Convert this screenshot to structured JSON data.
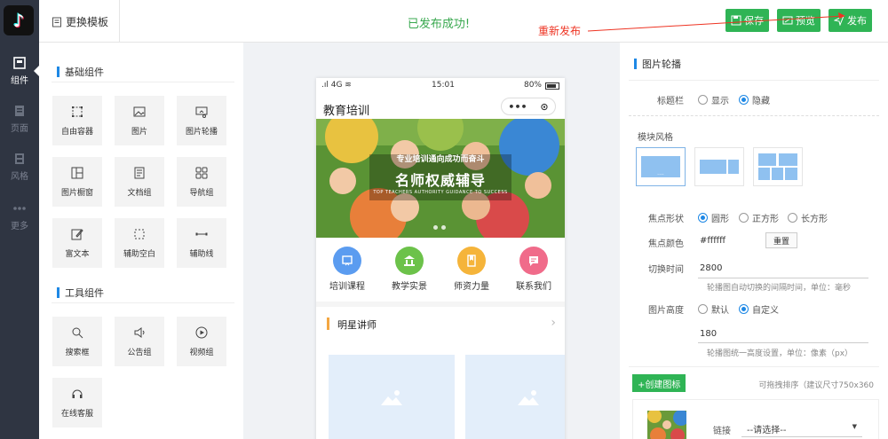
{
  "topbar": {
    "template_label": "更换模板",
    "status": "已发布成功!",
    "save_label": "保存",
    "preview_label": "预览",
    "publish_label": "发布",
    "annotation": "重新发布"
  },
  "rail": {
    "items": [
      {
        "label": "组件",
        "icon": "component-icon",
        "active": true
      },
      {
        "label": "页面",
        "icon": "page-icon",
        "active": false
      },
      {
        "label": "风格",
        "icon": "style-icon",
        "active": false
      },
      {
        "label": "更多",
        "icon": "more-icon",
        "active": false
      }
    ]
  },
  "components": {
    "basic_title": "基础组件",
    "basic": [
      {
        "label": "自由容器",
        "icon": "free-container-icon"
      },
      {
        "label": "图片",
        "icon": "image-icon"
      },
      {
        "label": "图片轮播",
        "icon": "carousel-icon"
      },
      {
        "label": "图片橱窗",
        "icon": "showcase-icon"
      },
      {
        "label": "文档组",
        "icon": "document-icon"
      },
      {
        "label": "导航组",
        "icon": "navigation-icon"
      },
      {
        "label": "富文本",
        "icon": "rich-text-icon"
      },
      {
        "label": "辅助空白",
        "icon": "blank-icon"
      },
      {
        "label": "辅助线",
        "icon": "divider-icon"
      }
    ],
    "tool_title": "工具组件",
    "tools": [
      {
        "label": "搜索框",
        "icon": "search-icon"
      },
      {
        "label": "公告组",
        "icon": "announcement-icon"
      },
      {
        "label": "视频组",
        "icon": "video-icon"
      },
      {
        "label": "在线客服",
        "icon": "headset-icon"
      }
    ]
  },
  "phone": {
    "signal": "4G",
    "time": "15:01",
    "battery": "80%",
    "title": "教育培训",
    "banner": {
      "subtitle": "专业培训通向成功而奋斗",
      "headline": "名师权威辅导",
      "english": "TOP TEACHERS AUTHORITY GUIDANCE TO SUCCESS"
    },
    "nav": [
      {
        "label": "培训课程",
        "color": "#5b9cf0",
        "icon": "course-icon"
      },
      {
        "label": "教学实景",
        "color": "#6cc24a",
        "icon": "building-icon"
      },
      {
        "label": "师资力量",
        "color": "#f5b43a",
        "icon": "teacher-icon"
      },
      {
        "label": "联系我们",
        "color": "#f06b8a",
        "icon": "chat-icon"
      }
    ],
    "section_title": "明星讲师"
  },
  "settings": {
    "title": "图片轮播",
    "titlebar_label": "标题栏",
    "titlebar_options": [
      "显示",
      "隐藏"
    ],
    "titlebar_selected": 1,
    "module_style_label": "模块风格",
    "focus_shape_label": "焦点形状",
    "focus_shapes": [
      "圆形",
      "正方形",
      "长方形"
    ],
    "focus_selected": 0,
    "focus_color_label": "焦点颜色",
    "focus_color_value": "#ffffff",
    "reset_label": "重置",
    "switch_time_label": "切换时间",
    "switch_time_value": "2800",
    "switch_time_hint": "轮播图自动切换的间隔时间，单位：毫秒",
    "img_height_label": "图片高度",
    "img_height_options": [
      "默认",
      "自定义"
    ],
    "img_height_selected": 1,
    "img_height_value": "180",
    "img_height_hint": "轮播图统一高度设置，单位：像素（px）",
    "create_label": "+创建图标",
    "sort_hint": "可拖拽排序（建议尺寸750x360",
    "link_label": "链接",
    "link_select": "--请选择--"
  },
  "colors": {
    "accent_green": "#2fb455",
    "accent_blue": "#1e88e5",
    "rail_bg": "#2f3542"
  }
}
